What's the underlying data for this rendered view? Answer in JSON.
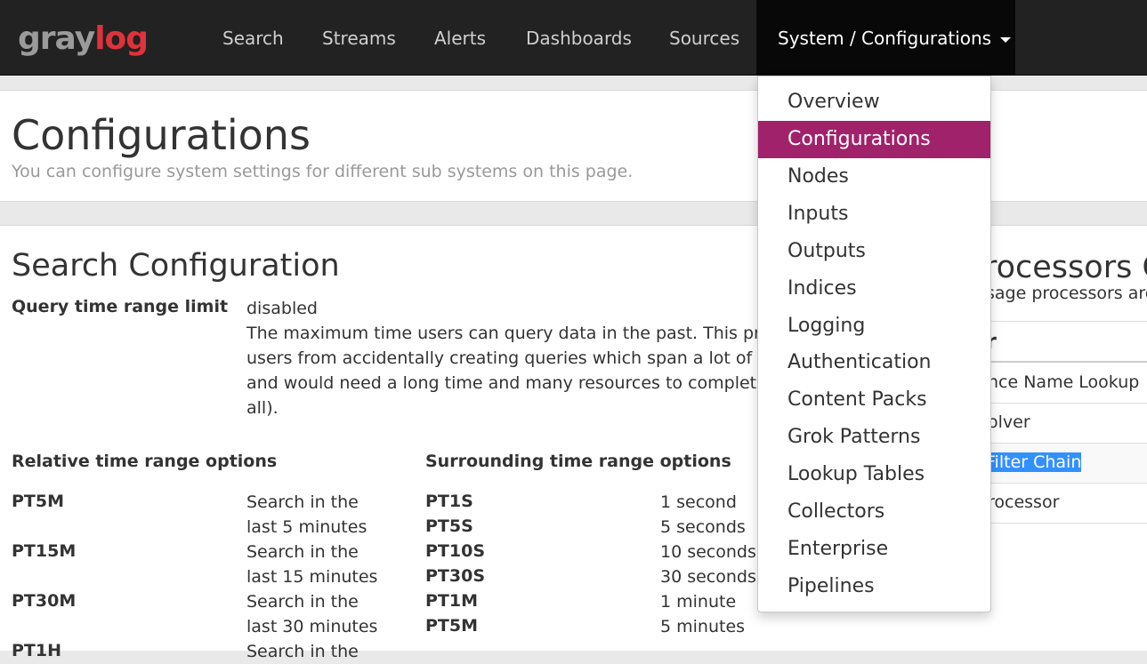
{
  "navbar": {
    "logo": {
      "part1": "gray",
      "part2": "log"
    },
    "items": [
      {
        "label": "Search"
      },
      {
        "label": "Streams"
      },
      {
        "label": "Alerts"
      },
      {
        "label": "Dashboards"
      },
      {
        "label": "Sources"
      }
    ],
    "active_item": {
      "label": "System / Configurations"
    }
  },
  "dropdown": {
    "items": [
      {
        "label": "Overview"
      },
      {
        "label": "Configurations",
        "active": true
      },
      {
        "label": "Nodes"
      },
      {
        "label": "Inputs"
      },
      {
        "label": "Outputs"
      },
      {
        "label": "Indices"
      },
      {
        "label": "Logging"
      },
      {
        "label": "Authentication"
      },
      {
        "label": "Content Packs"
      },
      {
        "label": "Grok Patterns"
      },
      {
        "label": "Lookup Tables"
      },
      {
        "label": "Collectors"
      },
      {
        "label": "Enterprise"
      },
      {
        "label": "Pipelines"
      }
    ]
  },
  "page": {
    "title": "Configurations",
    "description": "You can configure system settings for different sub systems on this page."
  },
  "search_config": {
    "title": "Search Configuration",
    "query_limit": {
      "label": "Query time range limit",
      "value": "disabled",
      "description_lines": [
        "The maximum time users can query data in the past. This prev",
        "users from accidentally creating queries which span a lot of da",
        "and would need a long time and many resources to complete (",
        "all)."
      ]
    },
    "relative": {
      "title": "Relative time range options",
      "rows": [
        {
          "key": "PT5M",
          "line1": "Search in the",
          "line2": "last 5 minutes"
        },
        {
          "key": "PT15M",
          "line1": "Search in the",
          "line2": "last 15 minutes"
        },
        {
          "key": "PT30M",
          "line1": "Search in the",
          "line2": "last 30 minutes"
        },
        {
          "key": "PT1H",
          "line1": "Search in the",
          "line2": ""
        }
      ]
    },
    "surrounding": {
      "title": "Surrounding time range options",
      "rows": [
        {
          "key": "PT1S",
          "value": "1 second"
        },
        {
          "key": "PT5S",
          "value": "5 seconds"
        },
        {
          "key": "PT10S",
          "value": "10 seconds"
        },
        {
          "key": "PT30S",
          "value": "30 seconds"
        },
        {
          "key": "PT1M",
          "value": "1 minute"
        },
        {
          "key": "PT5M",
          "value": "5 minutes"
        }
      ]
    }
  },
  "processors": {
    "title_fragment": "rocessors C",
    "desc_fragment": "sage processors are",
    "header_fragment": "r",
    "table_header_fragment": "nce Name Lookup",
    "rows": [
      "olver",
      "Filter Chain",
      "rocessor"
    ]
  },
  "colors": {
    "navbar_bg": "#222222",
    "active_nav_bg": "#080808",
    "dropdown_active": "#a0226a",
    "logo_red": "#e0323a",
    "selection": "#3390ff"
  }
}
